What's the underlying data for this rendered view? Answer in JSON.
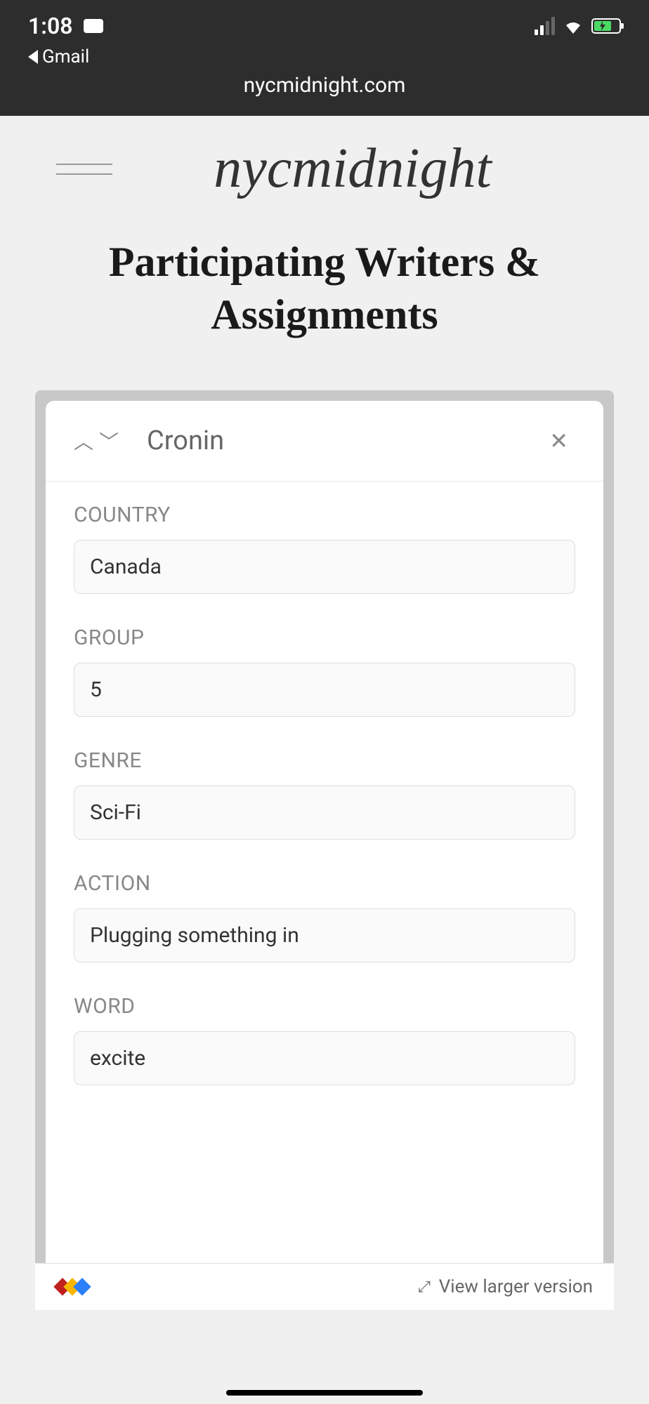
{
  "status_bar": {
    "time": "1:08",
    "back_app": "Gmail"
  },
  "browser": {
    "url": "nycmidnight.com"
  },
  "site": {
    "logo_text": "nycmidnight",
    "page_title": "Participating Writers & Assignments"
  },
  "record": {
    "name": "Cronin",
    "fields": [
      {
        "label": "COUNTRY",
        "value": "Canada"
      },
      {
        "label": "GROUP",
        "value": "5"
      },
      {
        "label": "GENRE",
        "value": "Sci-Fi"
      },
      {
        "label": "ACTION",
        "value": "Plugging something in"
      },
      {
        "label": "WORD",
        "value": "excite"
      }
    ]
  },
  "embed_footer": {
    "view_larger": "View larger version"
  }
}
